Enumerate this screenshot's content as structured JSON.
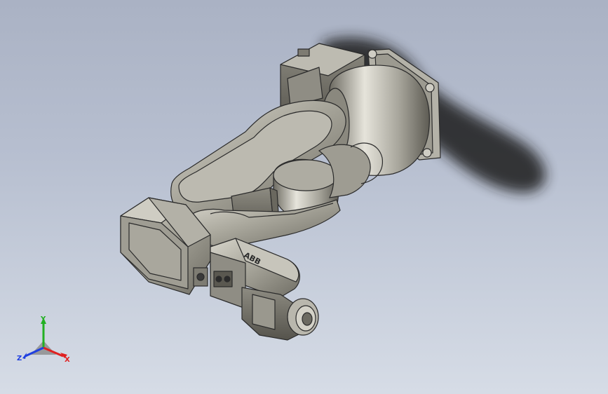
{
  "viewport": {
    "background_top": "#aab2c4",
    "background_bottom": "#d6dce6"
  },
  "model": {
    "logo_text": "ABB",
    "body_color": "#a7a59a",
    "edge_color": "#2b2b2b"
  },
  "triad": {
    "x_label": "X",
    "y_label": "Y",
    "z_label": "Z",
    "x_color": "#e02020",
    "y_color": "#22b022",
    "z_color": "#2040e0"
  }
}
